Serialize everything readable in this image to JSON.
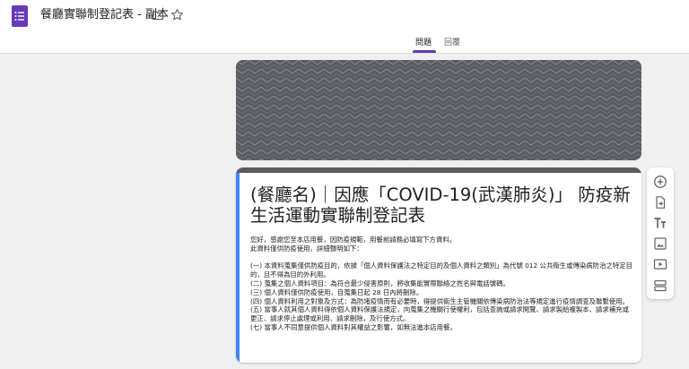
{
  "header": {
    "app_icon": "google-forms-icon",
    "doc_title": "餐廳實聯制登記表 - 副本",
    "folder_icon": "folder-icon",
    "star_icon": "star-icon",
    "tabs": [
      {
        "label": "問題",
        "active": true
      },
      {
        "label": "回覆",
        "active": false
      }
    ]
  },
  "theme": {
    "accent": "#673ab7",
    "card_header": "#5b5b63",
    "focus_bar": "#4285f4",
    "background": "#f0f0f0"
  },
  "form": {
    "title": "(餐廳名)｜因應「COVID-19(武漢肺炎)」 防疫新生活運動實聯制登記表",
    "description": [
      "您好，感謝您至本店用餐，因防疫規範，用餐前請務必填寫下方資料。",
      "此資料僅供防疫使用，詳細聲明如下：",
      "",
      "(一) 本資料蒐集僅供防疫目的，依據「個人資料保護法之特定目的及個人資料之類別」為代號 012 公共衛生或傳染病防治之特定目的，且不得為目的外利用。",
      "(二) 蒐集之個人資料項目：為符合最少侵害原則，將收集能實際聯絡之姓名與電話號碼。",
      "(三) 個人資料僅供防疫使用，自蒐集日起 28 日內將刪除。",
      "(四) 個人資料利用之對象及方式：為防堵疫情而有必要時，得提供衛生主管機關依傳染病防治法等規定進行疫情調查及聯繫使用。",
      "(五) 當事人就其個人資料得依個人資料保護法規定，向蒐集之機關行使權利，包括查詢或請求閱覽、請求製給複製本、請求補充或更正、請求停止處理或利用、請求刪除，及行使方式。",
      "(七) 當事人不同意提供個人資料對其權益之影響，如無法進本店用餐。"
    ]
  },
  "side_toolbar": [
    {
      "icon": "add-question-icon"
    },
    {
      "icon": "import-questions-icon"
    },
    {
      "icon": "add-title-icon"
    },
    {
      "icon": "add-image-icon"
    },
    {
      "icon": "add-video-icon"
    },
    {
      "icon": "add-section-icon"
    }
  ]
}
